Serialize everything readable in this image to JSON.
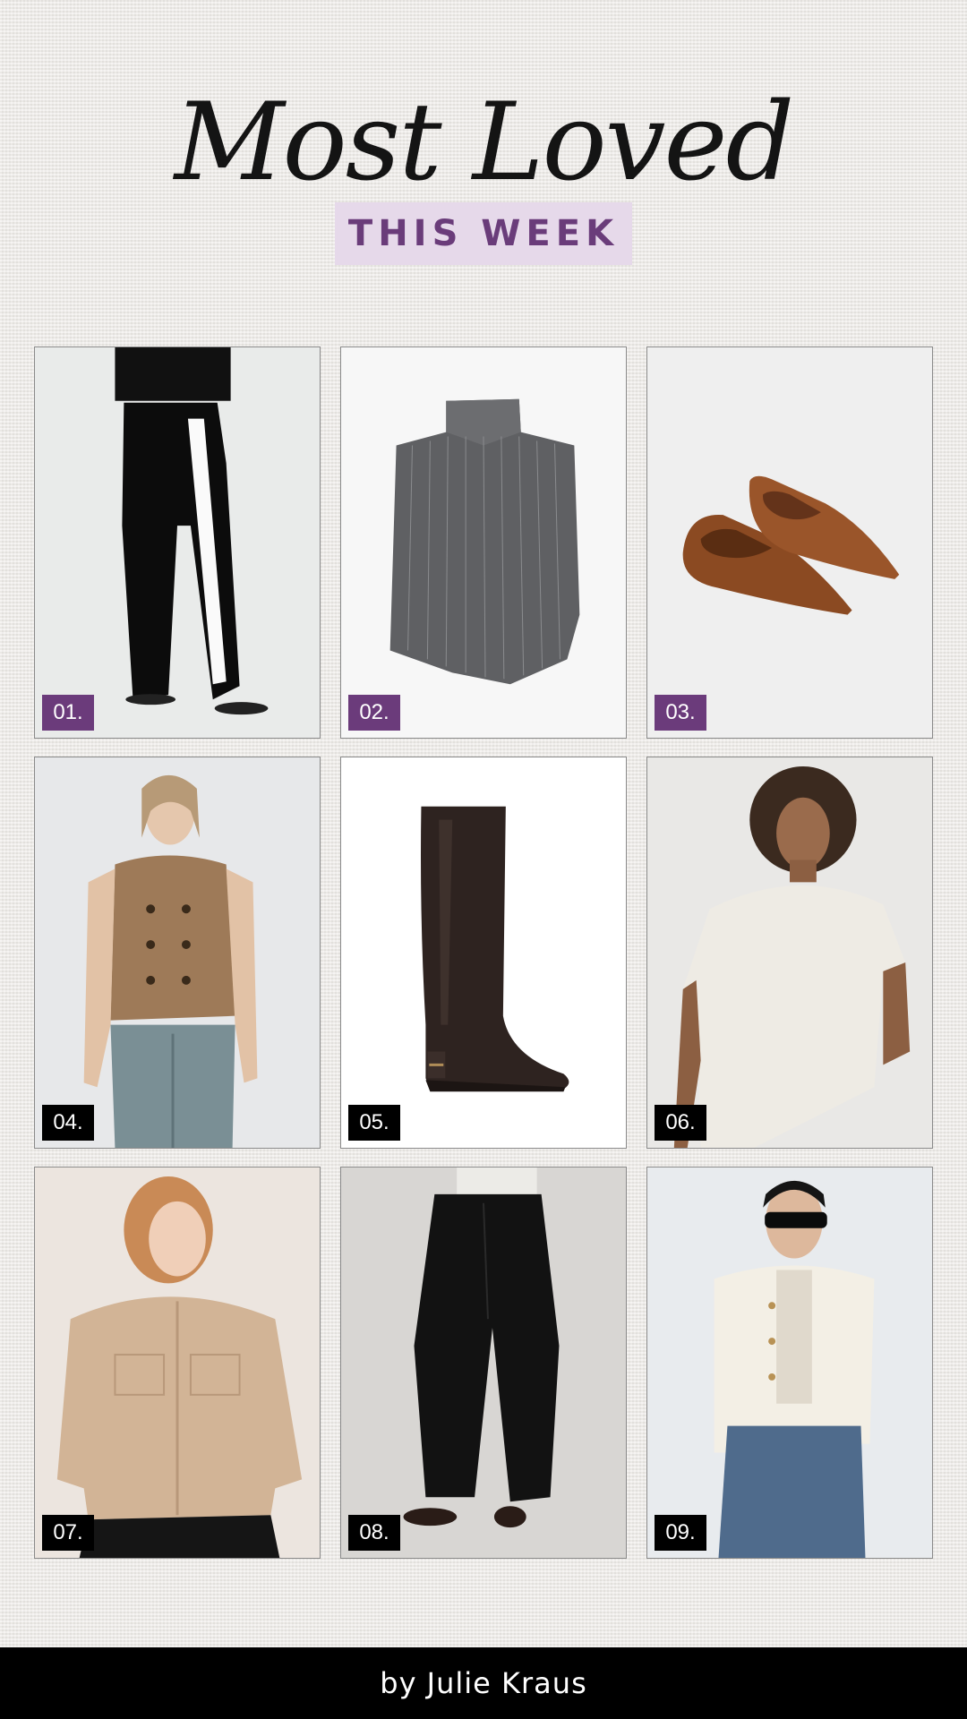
{
  "header": {
    "title": "Most Loved",
    "subtitle": "THIS WEEK"
  },
  "colors": {
    "background": "#ece9e6",
    "accent_purple": "#6b3b7b",
    "subtitle_bg": "#e6d9ea",
    "footer_bg": "#000000"
  },
  "products": [
    {
      "number": "01.",
      "item": "black-wide-leg-pants-with-white-side-stripe",
      "badge_color": "purple"
    },
    {
      "number": "02.",
      "item": "grey-pinstripe-sleeveless-mock-neck-top",
      "badge_color": "purple"
    },
    {
      "number": "03.",
      "item": "brown-suede-pointed-flats",
      "badge_color": "purple"
    },
    {
      "number": "04.",
      "item": "tan-double-breasted-sleeveless-vest",
      "badge_color": "black"
    },
    {
      "number": "05.",
      "item": "dark-brown-knee-high-leather-boot",
      "badge_color": "black"
    },
    {
      "number": "06.",
      "item": "ivory-draped-asymmetric-top",
      "badge_color": "black"
    },
    {
      "number": "07.",
      "item": "beige-utility-bomber-jacket",
      "badge_color": "black"
    },
    {
      "number": "08.",
      "item": "black-pleated-barrel-trousers",
      "badge_color": "black"
    },
    {
      "number": "09.",
      "item": "cream-tweed-cropped-jacket",
      "badge_color": "black"
    }
  ],
  "footer": {
    "byline": "by Julie Kraus"
  }
}
